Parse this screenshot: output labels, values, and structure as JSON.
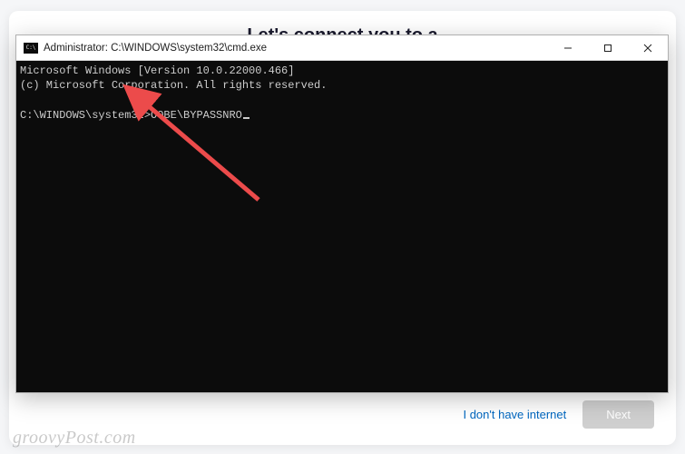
{
  "oobe": {
    "heading": "Let's connect you to a",
    "no_internet_label": "I don't have internet",
    "next_label": "Next"
  },
  "window": {
    "title": "Administrator: C:\\WINDOWS\\system32\\cmd.exe"
  },
  "terminal": {
    "line1": "Microsoft Windows [Version 10.0.22000.466]",
    "line2": "(c) Microsoft Corporation. All rights reserved.",
    "blank": "",
    "prompt": "C:\\WINDOWS\\system32>",
    "command": "OOBE\\BYPASSNRO"
  },
  "watermark": "groovyPost.com",
  "colors": {
    "terminal_bg": "#0c0c0c",
    "terminal_fg": "#cccccc",
    "arrow": "#ec4b4b",
    "link": "#0067c0"
  }
}
